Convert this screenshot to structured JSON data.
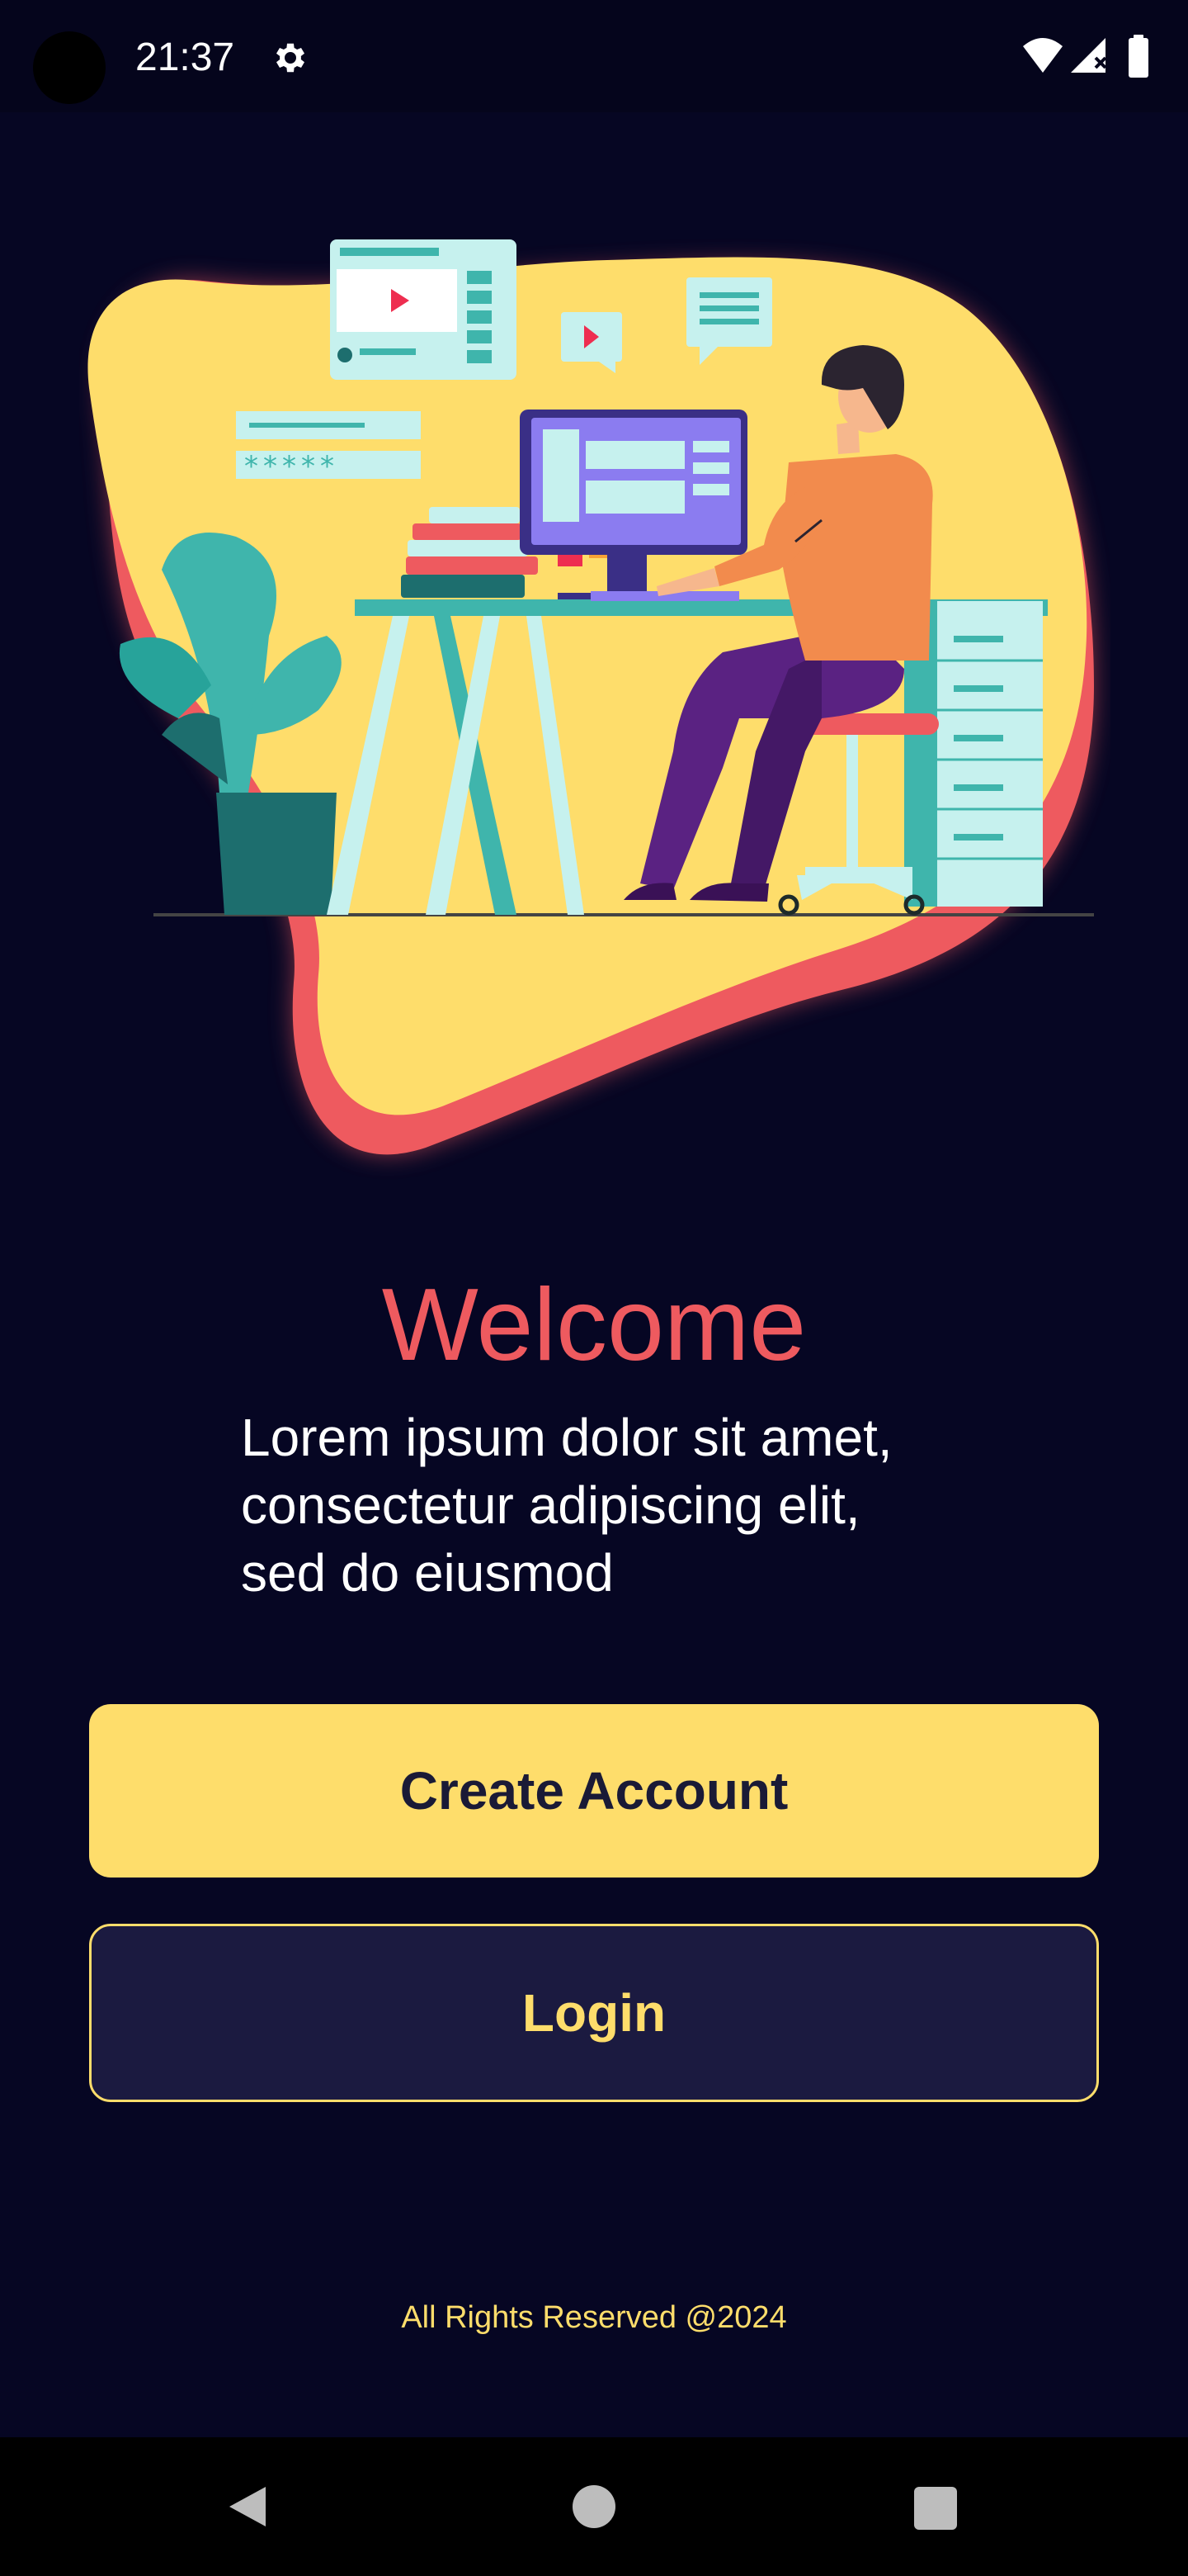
{
  "status_bar": {
    "time": "21:37",
    "icons": [
      "settings-icon",
      "wifi-icon",
      "signal-icon",
      "battery-icon"
    ]
  },
  "illustration": {
    "password_mask": "*****"
  },
  "welcome": {
    "title": "Welcome",
    "lines": [
      "Lorem ipsum dolor sit amet,",
      "consectetur adipiscing elit,",
      "sed do eiusmod"
    ]
  },
  "buttons": {
    "create_account": "Create Account",
    "login": "Login"
  },
  "footer": {
    "text": "All Rights Reserved @2024"
  },
  "colors": {
    "background": "#060623",
    "accent_yellow": "#fedd6b",
    "accent_red": "#ee5a5f",
    "login_bg": "#1b1a40"
  },
  "nav_bar": {
    "icons": [
      "back-icon",
      "home-icon",
      "recents-icon"
    ]
  }
}
